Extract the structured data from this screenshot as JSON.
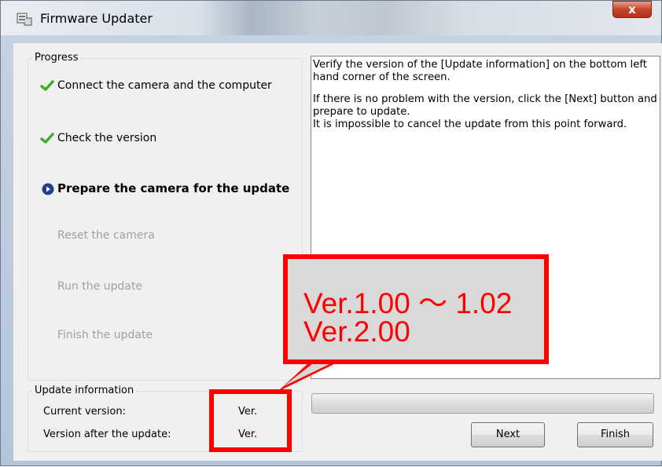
{
  "window": {
    "title": "Firmware Updater",
    "close_glyph": "x"
  },
  "progress": {
    "label": "Progress",
    "steps": [
      {
        "label": "Connect the camera and the computer",
        "state": "done",
        "icon": "check-icon"
      },
      {
        "label": "Check the version",
        "state": "done",
        "icon": "check-icon"
      },
      {
        "label": "Prepare the camera for the update",
        "state": "current",
        "icon": "arrow-circle-icon"
      },
      {
        "label": "Reset the camera",
        "state": "pending"
      },
      {
        "label": "Run the update",
        "state": "pending"
      },
      {
        "label": "Finish the update",
        "state": "pending"
      }
    ]
  },
  "instructions": {
    "p1": "Verify the version of the [Update information] on the bottom left hand corner of the screen.",
    "p2": "If there is no problem with the version, click the [Next] button and prepare to update.",
    "p3": "It is impossible to cancel the update from this point forward."
  },
  "update_info": {
    "label": "Update information",
    "current_label": "Current version:",
    "current_value": "Ver.",
    "after_label": "Version after the update:",
    "after_value": "Ver."
  },
  "buttons": {
    "next": "Next",
    "finish": "Finish"
  },
  "callout": {
    "line1": "Ver.1.00 〜 1.02",
    "line2": "Ver.2.00"
  },
  "colors": {
    "highlight": "#ff0000",
    "check": "#3fae2a",
    "current_step_icon": "#1f3f8f"
  }
}
